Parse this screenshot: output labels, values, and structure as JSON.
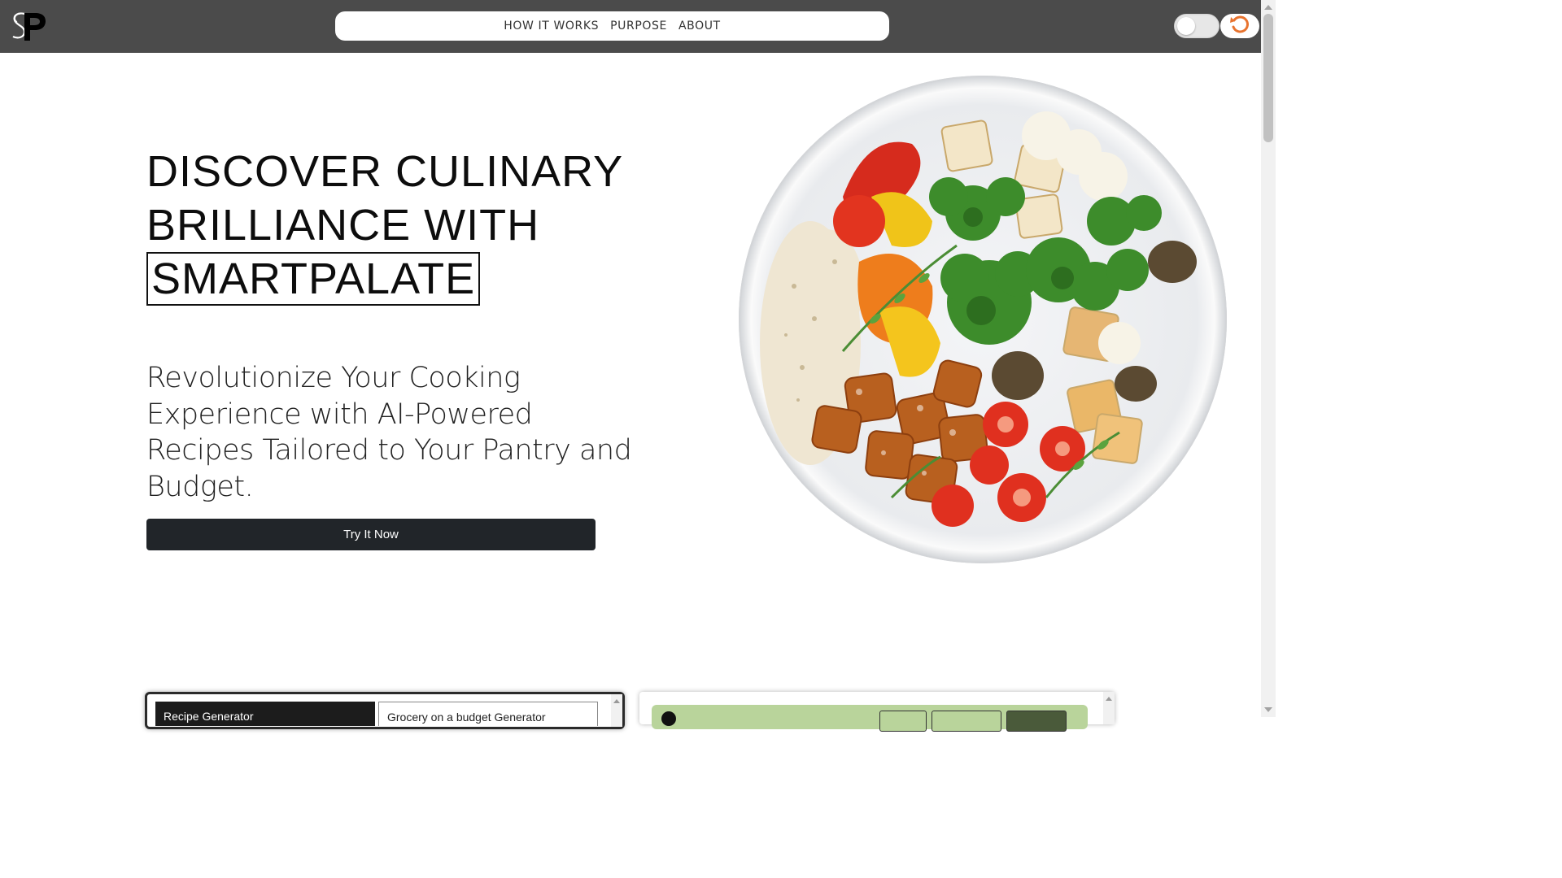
{
  "nav": {
    "items": [
      {
        "label": "HOW IT WORKS"
      },
      {
        "label": "PURPOSE"
      },
      {
        "label": "ABOUT"
      }
    ]
  },
  "header": {
    "logo_text": "SP",
    "theme_toggle_state": "off",
    "refresh_icon": "refresh-icon"
  },
  "hero": {
    "title_line1": "DISCOVER CULINARY",
    "title_line2": "BRILLIANCE WITH",
    "title_highlight": "SMARTPALATE",
    "subtitle": "Revolutionize Your Cooking Experience with AI-Powered Recipes Tailored to Your Pantry and Budget.",
    "cta_label": "Try It Now"
  },
  "tools": {
    "tab_recipe": "Recipe Generator",
    "tab_grocery": "Grocery on a budget Generator"
  },
  "colors": {
    "header_bg": "#4b4b4b",
    "cta_bg": "#212529",
    "accent_green": "#b9d49b",
    "refresh_orange": "#e8732e"
  }
}
